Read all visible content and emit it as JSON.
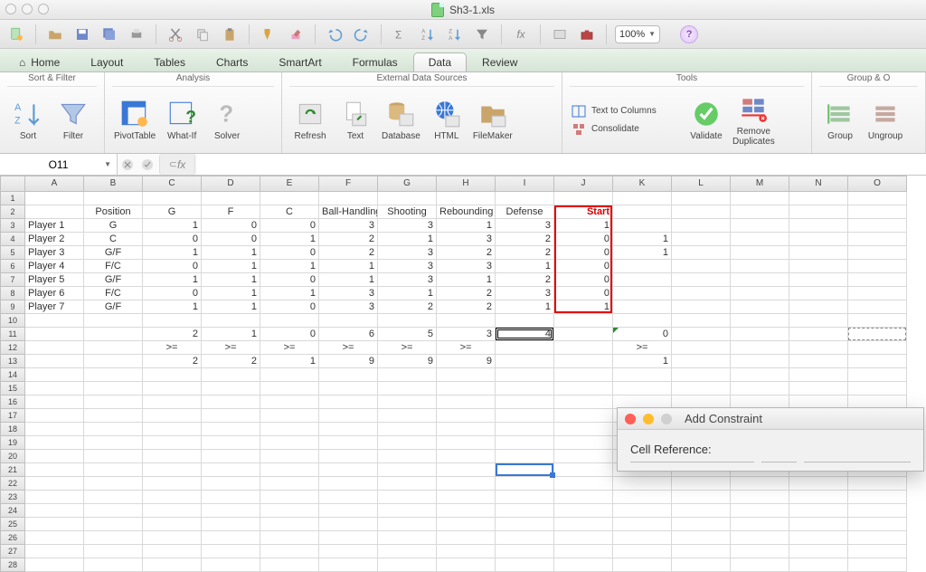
{
  "window": {
    "filename": "Sh3-1.xls"
  },
  "qtb": {
    "zoom": "100%"
  },
  "tabs": [
    "Home",
    "Layout",
    "Tables",
    "Charts",
    "SmartArt",
    "Formulas",
    "Data",
    "Review"
  ],
  "tabs_active": 6,
  "ribbon": {
    "groups": [
      {
        "name": "Sort & Filter",
        "buttons": [
          "Sort",
          "Filter"
        ]
      },
      {
        "name": "Analysis",
        "buttons": [
          "PivotTable",
          "What-If",
          "Solver"
        ]
      },
      {
        "name": "External Data Sources",
        "buttons": [
          "Refresh",
          "Text",
          "Database",
          "HTML",
          "FileMaker"
        ]
      },
      {
        "name": "Tools",
        "buttons": [
          "Validate",
          "Remove Duplicates"
        ],
        "mini": [
          "Text to Columns",
          "Consolidate"
        ]
      },
      {
        "name": "Group & O",
        "buttons": [
          "Group",
          "Ungroup"
        ]
      }
    ]
  },
  "formula_bar": {
    "name_box": "O11",
    "formula": ""
  },
  "columns": [
    "A",
    "B",
    "C",
    "D",
    "E",
    "F",
    "G",
    "H",
    "I",
    "J",
    "K",
    "L",
    "M",
    "N",
    "O"
  ],
  "rows": 28,
  "cells": {
    "r2": {
      "B": "Position",
      "C": "G",
      "D": "F",
      "E": "C",
      "F": "Ball-Handling",
      "G": "Shooting",
      "H": "Rebounding",
      "I": "Defense",
      "J": "Start"
    },
    "r3": {
      "A": "Player 1",
      "B": "G",
      "C": "1",
      "D": "0",
      "E": "0",
      "F": "3",
      "G": "3",
      "H": "1",
      "I": "3",
      "J": "1"
    },
    "r4": {
      "A": "Player 2",
      "B": "C",
      "C": "0",
      "D": "0",
      "E": "1",
      "F": "2",
      "G": "1",
      "H": "3",
      "I": "2",
      "J": "0",
      "K": "1"
    },
    "r5": {
      "A": "Player 3",
      "B": "G/F",
      "C": "1",
      "D": "1",
      "E": "0",
      "F": "2",
      "G": "3",
      "H": "2",
      "I": "2",
      "J": "0",
      "K": "1"
    },
    "r6": {
      "A": "Player 4",
      "B": "F/C",
      "C": "0",
      "D": "1",
      "E": "1",
      "F": "1",
      "G": "3",
      "H": "3",
      "I": "1",
      "J": "0"
    },
    "r7": {
      "A": "Player 5",
      "B": "G/F",
      "C": "1",
      "D": "1",
      "E": "0",
      "F": "1",
      "G": "3",
      "H": "1",
      "I": "2",
      "J": "0"
    },
    "r8": {
      "A": "Player 6",
      "B": "F/C",
      "C": "0",
      "D": "1",
      "E": "1",
      "F": "3",
      "G": "1",
      "H": "2",
      "I": "3",
      "J": "0"
    },
    "r9": {
      "A": "Player 7",
      "B": "G/F",
      "C": "1",
      "D": "1",
      "E": "0",
      "F": "3",
      "G": "2",
      "H": "2",
      "I": "1",
      "J": "1"
    },
    "r11": {
      "C": "2",
      "D": "1",
      "E": "0",
      "F": "6",
      "G": "5",
      "H": "3",
      "I": "4",
      "K": "0"
    },
    "r12": {
      "C": ">=",
      "D": ">=",
      "E": ">=",
      "F": ">=",
      "G": ">=",
      "H": ">=",
      "K": ">="
    },
    "r13": {
      "C": "2",
      "D": "2",
      "E": "1",
      "F": "9",
      "G": "9",
      "H": "9",
      "K": "1"
    }
  },
  "dialog": {
    "title": "Add Constraint",
    "cell_ref_label": "Cell Reference:"
  }
}
